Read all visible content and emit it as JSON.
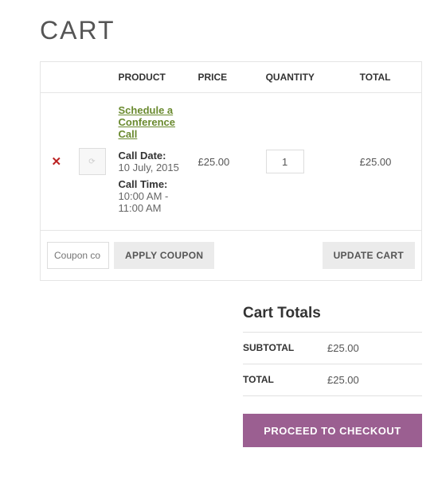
{
  "page": {
    "title": "CART"
  },
  "table": {
    "headers": {
      "product": "PRODUCT",
      "price": "PRICE",
      "quantity": "QUANTITY",
      "total": "TOTAL"
    }
  },
  "item": {
    "name": "Schedule a Conference Call",
    "meta": {
      "date_label": "Call Date:",
      "date_value": "10 July, 2015",
      "time_label": "Call Time:",
      "time_value": "10:00 AM - 11:00 AM"
    },
    "price": "£25.00",
    "quantity": "1",
    "total": "£25.00"
  },
  "actions": {
    "coupon_placeholder": "Coupon co",
    "apply_coupon": "APPLY COUPON",
    "update_cart": "UPDATE CART"
  },
  "totals": {
    "title": "Cart Totals",
    "subtotal_label": "SUBTOTAL",
    "subtotal_value": "£25.00",
    "total_label": "TOTAL",
    "total_value": "£25.00"
  },
  "checkout": {
    "label": "PROCEED TO CHECKOUT"
  }
}
